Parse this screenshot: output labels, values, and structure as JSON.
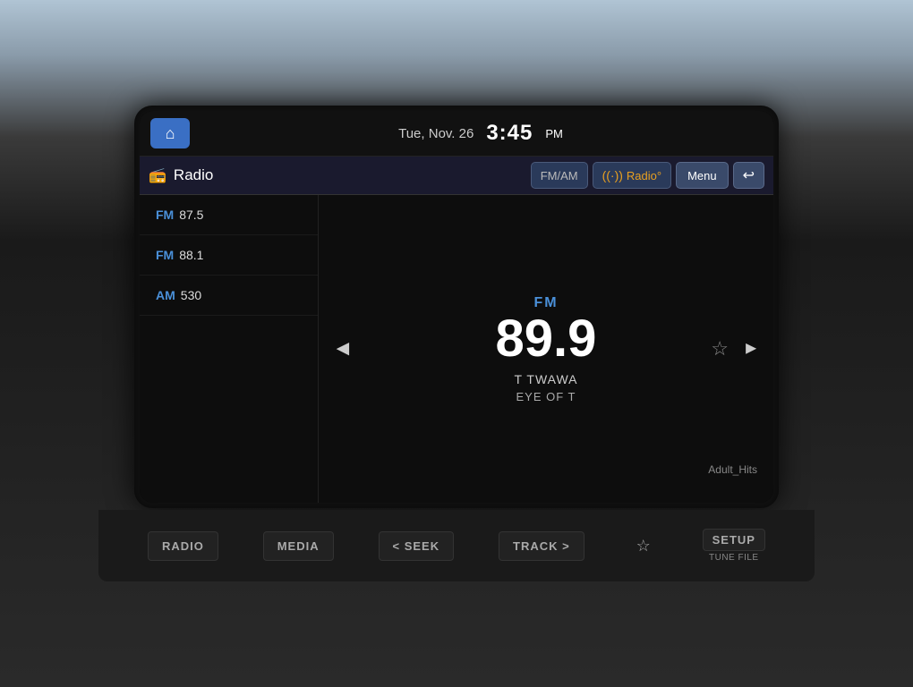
{
  "header": {
    "home_label": "⌂",
    "date": "Tue, Nov. 26",
    "time": "3:45",
    "ampm": "PM"
  },
  "titlebar": {
    "radio_icon": "📻",
    "title": "Radio",
    "fmam_label": "FM/AM",
    "hdradio_label": "Radio°",
    "hd_icon": "((·))",
    "menu_label": "Menu",
    "back_icon": "↩"
  },
  "stations": [
    {
      "band": "FM",
      "freq": "87.5"
    },
    {
      "band": "FM",
      "freq": "88.1"
    },
    {
      "band": "AM",
      "freq": "530"
    }
  ],
  "nowplaying": {
    "band": "FM",
    "frequency": "89.9",
    "station_name": "T TWAWA",
    "song_title": "EYE OF T",
    "genre": "Adult_Hits",
    "favorite_icon": "☆",
    "nav_left": "◄",
    "nav_right": "►"
  },
  "physical_buttons": {
    "radio_label": "RADIO",
    "media_label": "MEdIA",
    "seek_label": "< SEEK",
    "track_label": "TRACK >",
    "star_icon": "☆",
    "setup_label": "SETUP",
    "tune_file_label": "TUNE\nFILE"
  }
}
